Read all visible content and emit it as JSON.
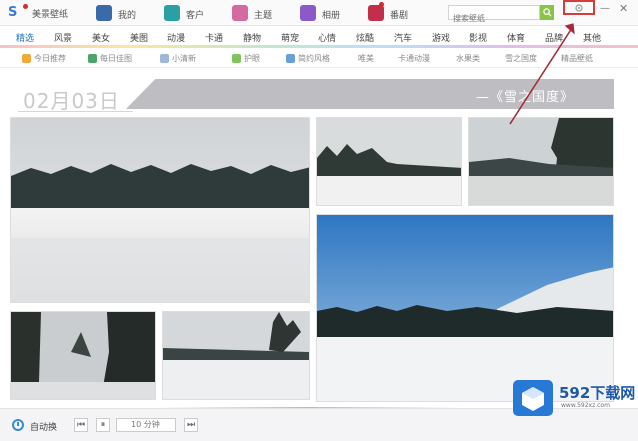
{
  "header": {
    "app_title": "美景壁纸",
    "tabs": [
      {
        "label": "我的",
        "icon": "my-icon",
        "color": "#3b6aa8",
        "dot": false
      },
      {
        "label": "客户",
        "icon": "client-icon",
        "color": "#2aa0a4",
        "dot": false
      },
      {
        "label": "主题",
        "icon": "theme-icon",
        "color": "#d56aa0",
        "dot": false
      },
      {
        "label": "相册",
        "icon": "album-icon",
        "color": "#8a5ac8",
        "dot": false
      },
      {
        "label": "番剧",
        "icon": "video-icon",
        "color": "#c0304a",
        "dot": true
      }
    ],
    "search_placeholder": "搜索壁纸"
  },
  "categories": [
    "精选",
    "风景",
    "美女",
    "美图",
    "动漫",
    "卡通",
    "静物",
    "萌宠",
    "心情",
    "炫酷",
    "汽车",
    "游戏",
    "影视",
    "体育",
    "品牌",
    "其他"
  ],
  "subtags": [
    {
      "label": "今日推荐",
      "color": "#f0a93a"
    },
    {
      "label": "每日佳图",
      "color": "#4aa56b"
    },
    {
      "label": "小清新",
      "color": "#9bbad6"
    },
    {
      "label": "护眼",
      "color": "#7ec45a"
    },
    {
      "label": "简约风格",
      "color": "#6aa0d8"
    },
    {
      "label": "唯美",
      "color": "#c9c9c9"
    },
    {
      "label": "卡通动漫",
      "color": "#c9c9c9"
    },
    {
      "label": "水果类",
      "color": "#c9c9c9"
    },
    {
      "label": "雪之国度",
      "color": "#c9c9c9"
    },
    {
      "label": "精品壁纸",
      "color": "#c9c9c9"
    }
  ],
  "album": {
    "date": "02月03日",
    "title": "—《雪之国度》"
  },
  "bottom": {
    "auto_label": "自动换",
    "interval": "10 分钟"
  },
  "watermark": {
    "name": "592下载网",
    "url": "www.592xz.com"
  }
}
